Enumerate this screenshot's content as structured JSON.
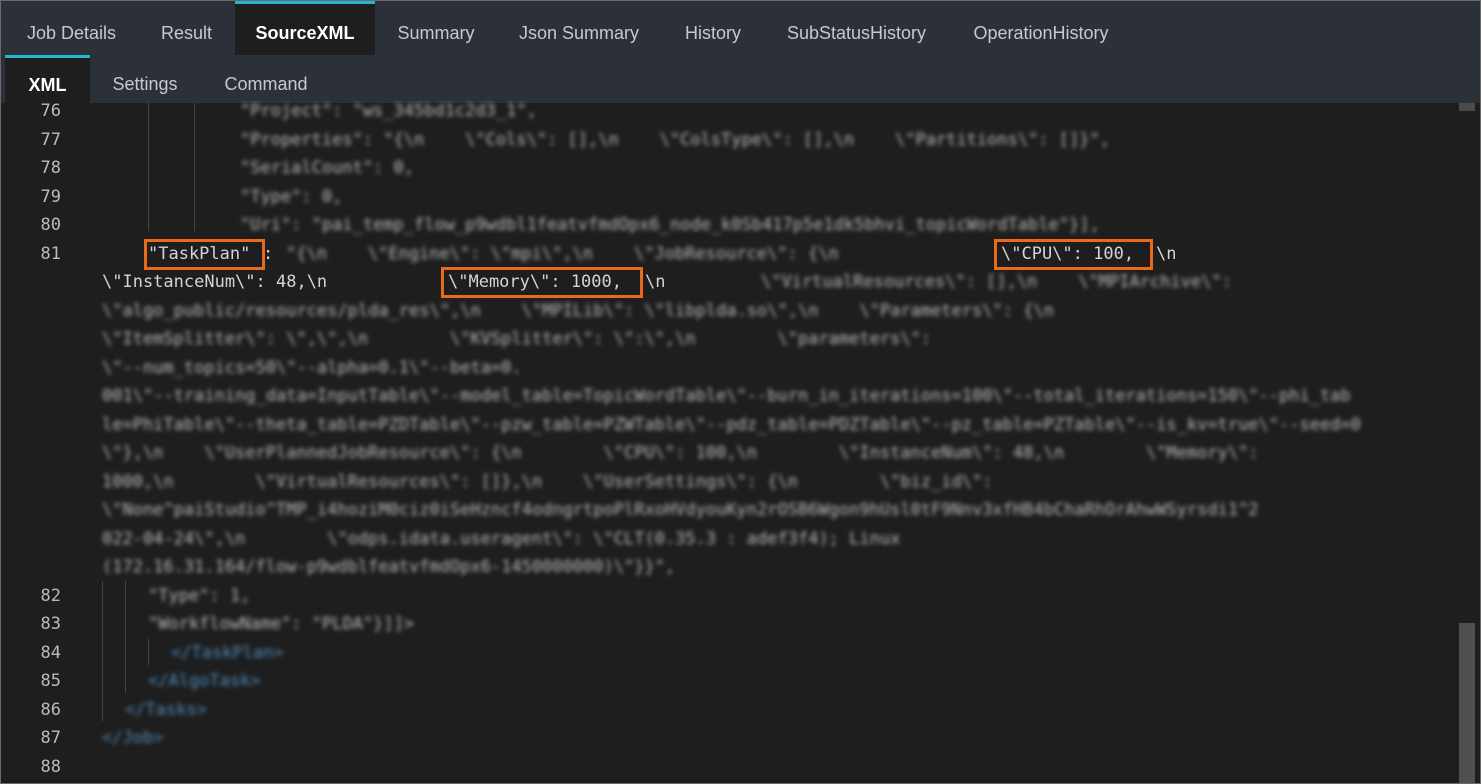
{
  "tabs_top": [
    {
      "label": "Job Details"
    },
    {
      "label": "Result"
    },
    {
      "label": "SourceXML"
    },
    {
      "label": "Summary"
    },
    {
      "label": "Json Summary"
    },
    {
      "label": "History"
    },
    {
      "label": "SubStatusHistory"
    },
    {
      "label": "OperationHistory"
    }
  ],
  "tabs_sub": [
    {
      "label": "XML"
    },
    {
      "label": "Settings"
    },
    {
      "label": "Command"
    }
  ],
  "editor": {
    "line_numbers": [
      "76",
      "77",
      "78",
      "79",
      "80",
      "81",
      "82",
      "83",
      "84",
      "85",
      "86",
      "87",
      "88"
    ],
    "visible": {
      "taskplan_key": "\"TaskPlan\"",
      "line81_sep": ": ",
      "cpu_text": "\\\"CPU\\\": 100,",
      "line81_tail": "\\n",
      "instancenum_text": "\\\"InstanceNum\\\": 48,\\n",
      "memory_text": "\\\"Memory\\\": 1000,",
      "memory_tail": "\\n"
    },
    "blurred": {
      "l76": "\"Project\": \"ws_345bd1c2d3_1\",",
      "l77": "\"Properties\": \"{\\n    \\\"Cols\\\": [],\\n    \\\"ColsType\\\": [],\\n    \\\"Partitions\\\": []}\",",
      "l78": "\"SerialCount\": 0,",
      "l79": "\"Type\": 0,",
      "l80": "\"Uri\": \"pai_temp_flow_p9wdbl1featvfmdOpx6_node_k0Sb417p5e1dk5bhvi_topicWordTable\"}],",
      "l81_mid": "\"{\\n    \\\"Engine\\\": \\\"mpi\\\",\\n    \\\"JobResource\\\": {\\n",
      "w2_tail": "\\\"VirtualResources\\\": [],\\n    \\\"MPIArchive\\\":",
      "w3": "\\\"algo_public/resources/plda_res\\\",\\n    \\\"MPILib\\\": \\\"libplda.so\\\",\\n    \\\"Parameters\\\": {\\n",
      "w4": "\\\"ItemSplitter\\\": \\\",\\\",\\n        \\\"KVSplitter\\\": \\\":\\\",\\n        \\\"parameters\\\":",
      "w5": "\\\"--num_topics=50\\\"--alpha=0.1\\\"--beta=0.",
      "w6": "001\\\"--training_data=InputTable\\\"--model_table=TopicWordTable\\\"--burn_in_iterations=100\\\"--total_iterations=150\\\"--phi_tab",
      "w7": "le=PhiTable\\\"--theta_table=PZDTable\\\"--pzw_table=PZWTable\\\"--pdz_table=PDZTable\\\"--pz_table=PZTable\\\"--is_kv=true\\\"--seed=0",
      "w8": "\\\"},\\n    \\\"UserPlannedJobResource\\\": {\\n        \\\"CPU\\\": 100,\\n        \\\"InstanceNum\\\": 48,\\n        \\\"Memory\\\":",
      "w9": "1000,\\n        \\\"VirtualResources\\\": []},\\n    \\\"UserSettings\\\": {\\n        \\\"biz_id\\\":",
      "w10": "\\\"None^paiStudio^TMP_i4hoziM0ciz0iSeHzncf4odngrtpoPlRxoHVdyouKyn2rOSB6Wgon9hUsl0tF9Nnv3xfHB4bChaRhOrAhwWSyrsdi1^2",
      "w11": "022-04-24\\\",\\n        \\\"odps.idata.useragent\\\": \\\"CLT(0.35.3 : adef3f4); Linux",
      "w12": "(172.16.31.164/flow-p9wdblfeatvfmdOpx6-1450000000)\\\"}}\",",
      "l82": "\"Type\": 1,",
      "l83": "\"WorkflowName\": \"PLDA\"}]]>",
      "l84": "</TaskPlan>",
      "l85": "</AlgoTask>",
      "l86": "</Tasks>",
      "l87": "</Job>"
    }
  },
  "colors": {
    "accent": "#22b6cf",
    "highlight": "#ea6a1a",
    "tab_bg": "#2c3039",
    "editor_bg": "#1e1e1e"
  }
}
